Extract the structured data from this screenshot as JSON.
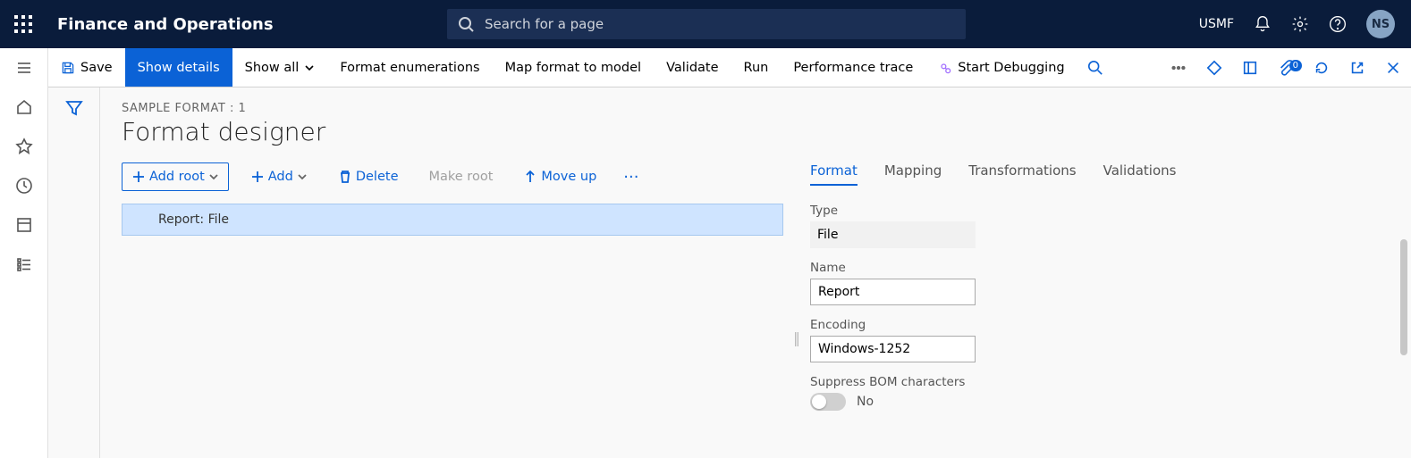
{
  "header": {
    "app_title": "Finance and Operations",
    "search_placeholder": "Search for a page",
    "company": "USMF",
    "avatar_initials": "NS"
  },
  "toolbar": {
    "save": "Save",
    "show_details": "Show details",
    "show_all": "Show all",
    "format_enum": "Format enumerations",
    "map_format": "Map format to model",
    "validate": "Validate",
    "run": "Run",
    "perf_trace": "Performance trace",
    "start_debug": "Start Debugging",
    "badge": "0"
  },
  "page": {
    "breadcrumb": "SAMPLE FORMAT : 1",
    "title": "Format designer"
  },
  "tree_toolbar": {
    "add_root": "Add root",
    "add": "Add",
    "delete": "Delete",
    "make_root": "Make root",
    "move_up": "Move up"
  },
  "tree": {
    "row0": "Report: File"
  },
  "props": {
    "tabs": {
      "format": "Format",
      "mapping": "Mapping",
      "transformations": "Transformations",
      "validations": "Validations"
    },
    "type_label": "Type",
    "type_value": "File",
    "name_label": "Name",
    "name_value": "Report",
    "encoding_label": "Encoding",
    "encoding_value": "Windows-1252",
    "bom_label": "Suppress BOM characters",
    "bom_value_text": "No"
  }
}
